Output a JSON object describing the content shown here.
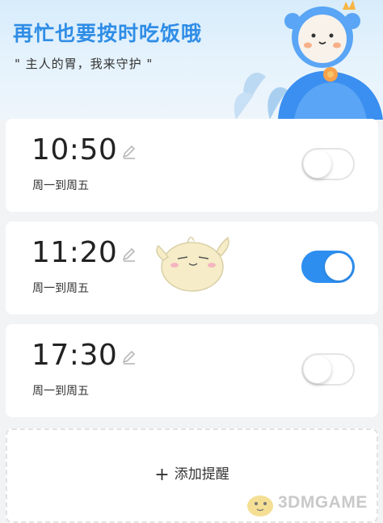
{
  "header": {
    "title": "再忙也要按时吃饭哦",
    "subtitle": "\" 主人的胃，我来守护 \""
  },
  "alarms": [
    {
      "time": "10:50",
      "repeat": "周一到周五",
      "enabled": false
    },
    {
      "time": "11:20",
      "repeat": "周一到周五",
      "enabled": true
    },
    {
      "time": "17:30",
      "repeat": "周一到周五",
      "enabled": false
    }
  ],
  "add_reminder": {
    "label": "添加提醒"
  },
  "watermark": {
    "text": "3DMGAME"
  },
  "colors": {
    "accent": "#2d8ef0",
    "title": "#2f8de6",
    "background": "#f2f3f5"
  },
  "icons": {
    "edit": "pencil-icon",
    "add": "plus-icon"
  }
}
